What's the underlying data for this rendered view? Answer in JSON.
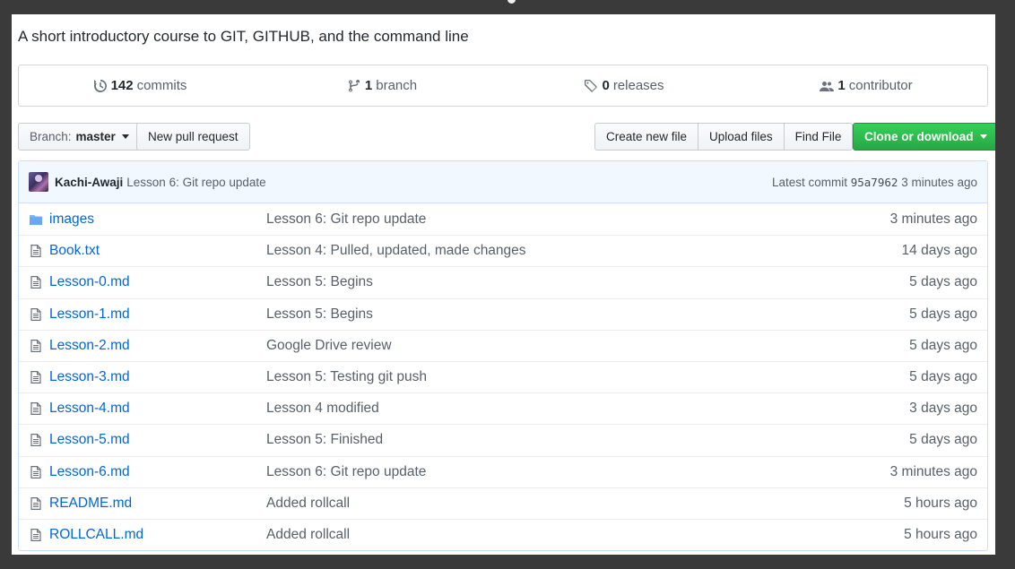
{
  "repo": {
    "description": "A short introductory course to GIT, GITHUB, and the command line"
  },
  "summary": {
    "commits": {
      "count": "142",
      "label": "commits",
      "icon": "history-icon"
    },
    "branches": {
      "count": "1",
      "label": "branch",
      "icon": "branch-icon"
    },
    "releases": {
      "count": "0",
      "label": "releases",
      "icon": "tag-icon"
    },
    "contributors": {
      "count": "1",
      "label": "contributor",
      "icon": "people-icon"
    }
  },
  "toolbar": {
    "branch_prefix": "Branch:",
    "branch_name": "master",
    "new_pr": "New pull request",
    "create_file": "Create new file",
    "upload_files": "Upload files",
    "find_file": "Find File",
    "clone": "Clone or download",
    "clone_color": "#28a745"
  },
  "latest_commit": {
    "author": "Kachi-Awaji",
    "message": "Lesson 6: Git repo update",
    "label": "Latest commit",
    "sha": "95a7962",
    "age": "3 minutes ago"
  },
  "files": [
    {
      "type": "folder",
      "name": "images",
      "message": "Lesson 6: Git repo update",
      "age": "3 minutes ago"
    },
    {
      "type": "file",
      "name": "Book.txt",
      "message": "Lesson 4: Pulled, updated, made changes",
      "age": "14 days ago"
    },
    {
      "type": "file",
      "name": "Lesson-0.md",
      "message": "Lesson 5: Begins",
      "age": "5 days ago"
    },
    {
      "type": "file",
      "name": "Lesson-1.md",
      "message": "Lesson 5: Begins",
      "age": "5 days ago"
    },
    {
      "type": "file",
      "name": "Lesson-2.md",
      "message": "Google Drive review",
      "age": "5 days ago"
    },
    {
      "type": "file",
      "name": "Lesson-3.md",
      "message": "Lesson 5: Testing git push",
      "age": "5 days ago"
    },
    {
      "type": "file",
      "name": "Lesson-4.md",
      "message": "Lesson 4 modified",
      "age": "3 days ago"
    },
    {
      "type": "file",
      "name": "Lesson-5.md",
      "message": "Lesson 5: Finished",
      "age": "5 days ago"
    },
    {
      "type": "file",
      "name": "Lesson-6.md",
      "message": "Lesson 6: Git repo update",
      "age": "3 minutes ago"
    },
    {
      "type": "file",
      "name": "README.md",
      "message": "Added rollcall",
      "age": "5 hours ago"
    },
    {
      "type": "file",
      "name": "ROLLCALL.md",
      "message": "Added rollcall",
      "age": "5 hours ago"
    }
  ]
}
